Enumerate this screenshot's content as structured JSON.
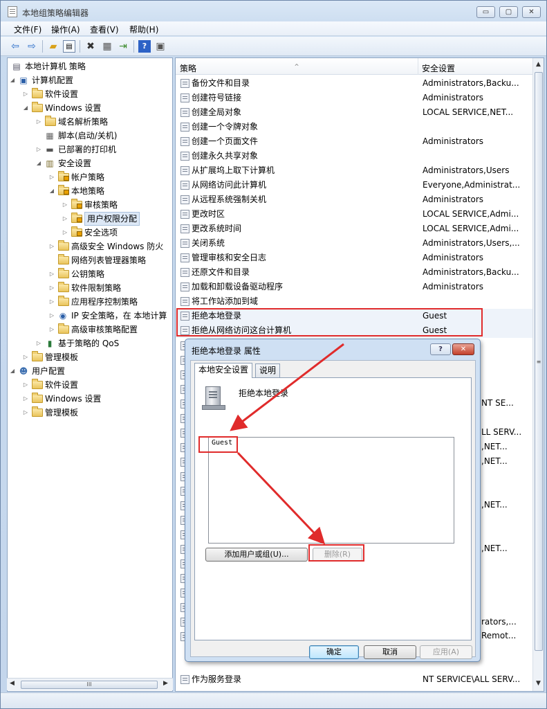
{
  "window": {
    "title": "本地组策略编辑器"
  },
  "menu": [
    "文件(F)",
    "操作(A)",
    "查看(V)",
    "帮助(H)"
  ],
  "toolbar": {
    "icons": [
      "back-arrow-icon",
      "forward-arrow-icon",
      "up-folder-icon",
      "show-hide-tree-icon",
      "delete-icon",
      "properties-icon",
      "export-list-icon",
      "help-icon",
      "view-icon"
    ]
  },
  "tree": {
    "items": [
      {
        "label": "本地计算机 策略",
        "level": 0,
        "icon": "policy"
      },
      {
        "label": "计算机配置",
        "level": 1,
        "icon": "computer",
        "expander": "◢"
      },
      {
        "label": "软件设置",
        "level": 2,
        "icon": "folder",
        "expander": "▷"
      },
      {
        "label": "Windows 设置",
        "level": 2,
        "icon": "folder",
        "expander": "◢"
      },
      {
        "label": "域名解析策略",
        "level": 3,
        "icon": "folder",
        "expander": "▷"
      },
      {
        "label": "脚本(启动/关机)",
        "level": 3,
        "icon": "script",
        "expander": ""
      },
      {
        "label": "已部署的打印机",
        "level": 3,
        "icon": "printer",
        "expander": "▷"
      },
      {
        "label": "安全设置",
        "level": 3,
        "icon": "security",
        "expander": "◢"
      },
      {
        "label": "帐户策略",
        "level": 4,
        "icon": "lockfolder",
        "expander": "▷"
      },
      {
        "label": "本地策略",
        "level": 4,
        "icon": "lockfolder",
        "expander": "◢"
      },
      {
        "label": "审核策略",
        "level": 5,
        "icon": "lockfolder",
        "expander": "▷"
      },
      {
        "label": "用户权限分配",
        "level": 5,
        "icon": "lockfolder",
        "expander": "▷",
        "selected": true
      },
      {
        "label": "安全选项",
        "level": 5,
        "icon": "lockfolder",
        "expander": "▷"
      },
      {
        "label": "高级安全 Windows 防火",
        "level": 4,
        "icon": "folder",
        "expander": "▷"
      },
      {
        "label": "网络列表管理器策略",
        "level": 4,
        "icon": "folder",
        "expander": ""
      },
      {
        "label": "公钥策略",
        "level": 4,
        "icon": "folder",
        "expander": "▷"
      },
      {
        "label": "软件限制策略",
        "level": 4,
        "icon": "folder",
        "expander": "▷"
      },
      {
        "label": "应用程序控制策略",
        "level": 4,
        "icon": "folder",
        "expander": "▷"
      },
      {
        "label": "IP 安全策略，在 本地计算",
        "level": 4,
        "icon": "ipsec",
        "expander": "▷"
      },
      {
        "label": "高级审核策略配置",
        "level": 4,
        "icon": "folder",
        "expander": "▷"
      },
      {
        "label": "基于策略的 QoS",
        "level": 3,
        "icon": "chart",
        "expander": "▷"
      },
      {
        "label": "管理模板",
        "level": 2,
        "icon": "folder",
        "expander": "▷"
      },
      {
        "label": "用户配置",
        "level": 1,
        "icon": "user",
        "expander": "◢"
      },
      {
        "label": "软件设置",
        "level": 2,
        "icon": "folder",
        "expander": "▷"
      },
      {
        "label": "Windows 设置",
        "level": 2,
        "icon": "folder",
        "expander": "▷"
      },
      {
        "label": "管理模板",
        "level": 2,
        "icon": "folder",
        "expander": "▷"
      }
    ],
    "hscroll_label": "III"
  },
  "list": {
    "columns": {
      "policy": "策略",
      "setting": "安全设置"
    },
    "rows": [
      {
        "name": "备份文件和目录",
        "value": "Administrators,Backu..."
      },
      {
        "name": "创建符号链接",
        "value": "Administrators"
      },
      {
        "name": "创建全局对象",
        "value": "LOCAL SERVICE,NET..."
      },
      {
        "name": "创建一个令牌对象",
        "value": ""
      },
      {
        "name": "创建一个页面文件",
        "value": "Administrators"
      },
      {
        "name": "创建永久共享对象",
        "value": ""
      },
      {
        "name": "从扩展坞上取下计算机",
        "value": "Administrators,Users"
      },
      {
        "name": "从网络访问此计算机",
        "value": "Everyone,Administrat..."
      },
      {
        "name": "从远程系统强制关机",
        "value": "Administrators"
      },
      {
        "name": "更改时区",
        "value": "LOCAL SERVICE,Admi..."
      },
      {
        "name": "更改系统时间",
        "value": "LOCAL SERVICE,Admi..."
      },
      {
        "name": "关闭系统",
        "value": "Administrators,Users,..."
      },
      {
        "name": "管理审核和安全日志",
        "value": "Administrators"
      },
      {
        "name": "还原文件和目录",
        "value": "Administrators,Backu..."
      },
      {
        "name": "加载和卸载设备驱动程序",
        "value": "Administrators"
      },
      {
        "name": "将工作站添加到域",
        "value": ""
      },
      {
        "name": "拒绝本地登录",
        "value": "Guest"
      },
      {
        "name": "拒绝从网络访问这台计算机",
        "value": "Guest"
      }
    ],
    "partial_values": [
      "NT SE...",
      "LL SERV...",
      ",NET...",
      ",NET...",
      ",NET...",
      ",NET...",
      "rators,...",
      "Remot..."
    ],
    "bottom_rows": [
      {
        "name": "作为服务登录",
        "value": "NT SERVICE\\ALL SERV..."
      }
    ],
    "vscroll_grip": "≡"
  },
  "dialog": {
    "title": "拒绝本地登录 属性",
    "help_label": "?",
    "close_label": "✕",
    "tabs": [
      "本地安全设置",
      "说明"
    ],
    "policy_name": "拒绝本地登录",
    "users": [
      "Guest"
    ],
    "add_button": "添加用户或组(U)...",
    "remove_button": "删除(R)",
    "ok_button": "确定",
    "cancel_button": "取消",
    "apply_button": "应用(A)"
  },
  "colors": {
    "annotation": "#e02b2b",
    "title_gradient": "#c9dbef"
  }
}
